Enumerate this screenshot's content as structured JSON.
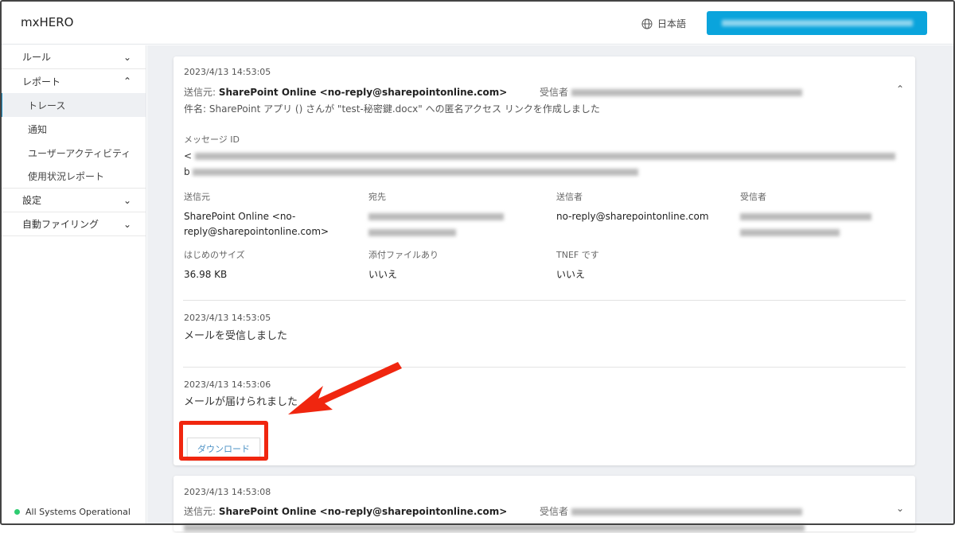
{
  "header": {
    "logo": "mxHERO",
    "language": "日本語"
  },
  "sidebar": {
    "items": [
      {
        "label": "ルール"
      },
      {
        "label": "レポート"
      },
      {
        "label": "設定"
      },
      {
        "label": "自動ファイリング"
      }
    ],
    "report_sub": [
      {
        "label": "トレース"
      },
      {
        "label": "通知"
      },
      {
        "label": "ユーザーアクティビティ"
      },
      {
        "label": "使用状況レポート"
      }
    ],
    "status": "All Systems Operational"
  },
  "card1": {
    "timestamp": "2023/4/13 14:53:05",
    "from_label": "送信元:",
    "from": "SharePoint Online <no-reply@sharepointonline.com>",
    "recipient_label": "受信者",
    "subject_label": "件名:",
    "subject": "SharePoint アプリ () さんが \"test-秘密鍵.docx\" への匿名アクセス リンクを作成しました",
    "message_id_label": "メッセージ ID",
    "message_id_start1": "<",
    "message_id_start2": "b",
    "fields": {
      "from_label": "送信元",
      "from_value": "SharePoint Online <no-reply@sharepointonline.com>",
      "to_label": "宛先",
      "sender_label": "送信者",
      "sender_value": "no-reply@sharepointonline.com",
      "recipient_label": "受信者",
      "size_label": "はじめのサイズ",
      "size_value": "36.98 KB",
      "attach_label": "添付ファイルあり",
      "attach_value": "いいえ",
      "tnef_label": "TNEF です",
      "tnef_value": "いいえ"
    },
    "events": [
      {
        "timestamp": "2023/4/13 14:53:05",
        "text": "メールを受信しました"
      },
      {
        "timestamp": "2023/4/13 14:53:06",
        "text": "メールが届けられました"
      }
    ],
    "download": "ダウンロード"
  },
  "card2": {
    "timestamp": "2023/4/13 14:53:08",
    "from_label": "送信元:",
    "from": "SharePoint Online <no-reply@sharepointonline.com>",
    "recipient_label": "受信者"
  }
}
